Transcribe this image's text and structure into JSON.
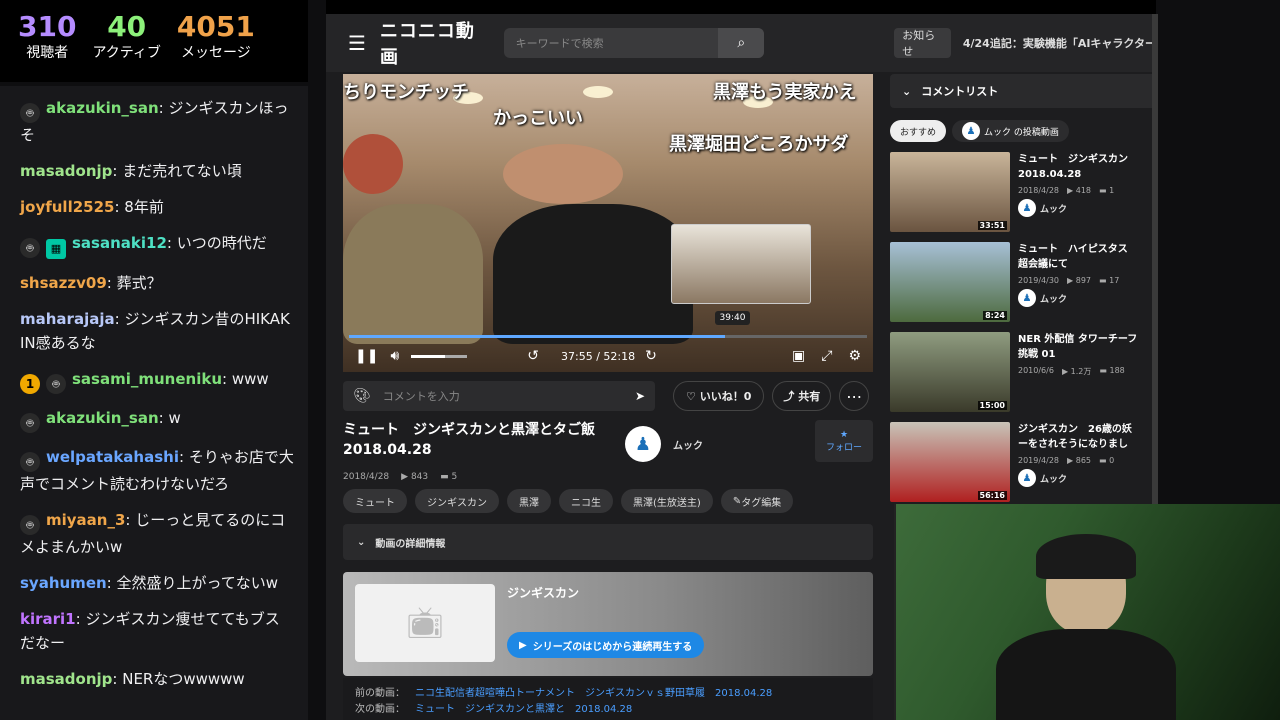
{
  "stats": [
    {
      "value": "310",
      "label": "視聴者",
      "color": "#b58cff"
    },
    {
      "value": "40",
      "label": "アクティブ",
      "color": "#8cf07a"
    },
    {
      "value": "4051",
      "label": "メッセージ",
      "color": "#f0a24a"
    }
  ],
  "chat": [
    {
      "badge": "bot",
      "user": "akazukin_san",
      "color": "#7fe07a",
      "text": "ジンギスカンほっそ"
    },
    {
      "user": "masadonjp",
      "color": "#a0e48c",
      "text": "まだ売れてない頃"
    },
    {
      "user": "joyfull2525",
      "color": "#f0a64a",
      "text": "8年前"
    },
    {
      "badge": "bot",
      "badge2": "gift",
      "user": "sasanaki12",
      "color": "#4ee0c4",
      "text": "いつの時代だ"
    },
    {
      "user": "shsazzv09",
      "color": "#f0a64a",
      "text": "葬式？"
    },
    {
      "user": "maharajaja",
      "color": "#b8c8f8",
      "text": "ジンギスカン昔のHIKAKIN感あるな"
    },
    {
      "badge": "rank",
      "rank": "1",
      "badge2": "bot",
      "user": "sasami_muneniku",
      "color": "#7fe07a",
      "text": "www"
    },
    {
      "badge": "bot",
      "user": "akazukin_san",
      "color": "#7fe07a",
      "text": "w"
    },
    {
      "badge": "bot",
      "user": "welpatakahashi",
      "color": "#6aa6ff",
      "text": "そりゃお店で大声でコメント読むわけないだろ"
    },
    {
      "badge": "bot",
      "user": "miyaan_3",
      "color": "#f0a64a",
      "text": "じーっと見てるのにコメよまんかいw"
    },
    {
      "user": "syahumen",
      "color": "#6aa6ff",
      "text": "全然盛り上がってないw"
    },
    {
      "user": "kirari1",
      "color": "#c074ff",
      "text": "ジンギスカン痩せててもブスだなー"
    },
    {
      "user": "masadonjp",
      "color": "#a0e48c",
      "text": "NERなつwwwww"
    }
  ],
  "header": {
    "logo": "ニコニコ動画",
    "search_placeholder": "キーワードで検索",
    "notice": "お知らせ",
    "notice_text": "4/24追記：実験機能「AIキャラクター"
  },
  "player": {
    "danmaku": [
      "ちりモンチッチ",
      "かっこいい",
      "黒澤もう実家かえ",
      "黒澤堀田どころかサダ"
    ],
    "tooltip_time": "39:40",
    "time": "37:55 / 52:18",
    "progress": 0.725,
    "volume": 0.6
  },
  "actions": {
    "comment_placeholder": "コメントを入力",
    "like": "いいね！0",
    "share": "共有"
  },
  "video": {
    "title": "ミュート　ジンギスカンと黒澤とタご飯 2018.04.28",
    "date": "2018/4/28",
    "views": "843",
    "comments": "5",
    "uploader": "ムック",
    "follow": "フォロー"
  },
  "tags": [
    "ミュート",
    "ジンギスカン",
    "黒澤",
    "ニコ生",
    "黒澤(生放送主)",
    "タグ編集"
  ],
  "detail_label": "動画の詳細情報",
  "series": {
    "name": "ジンギスカン",
    "play": "シリーズのはじめから連続再生する"
  },
  "prev": {
    "label": "前の動画：",
    "title": "ニコ生配信者超喧嘩凸トーナメント　ジンギスカンｖｓ野田草履　2018.04.28"
  },
  "next": {
    "label": "次の動画：",
    "title": "ミュート　ジンギスカンと黒澤と　2018.04.28"
  },
  "sidebar": {
    "heading": "コメントリスト",
    "tabs": [
      "おすすめ",
      "ムック の投稿動画"
    ],
    "items": [
      {
        "title1": "ミュート　ジンギスカン",
        "title2": "2018.04.28",
        "date": "2018/4/28",
        "views": "418",
        "comments": "1",
        "uploader": "ムック",
        "duration": "33:51",
        "colors": [
          "#c9b59a",
          "#6a5440"
        ]
      },
      {
        "title1": "ミュート　ハイピスタス",
        "title2": "超会議にて",
        "date": "2019/4/30",
        "views": "897",
        "comments": "17",
        "uploader": "ムック",
        "duration": "8:24",
        "colors": [
          "#a7c0d6",
          "#4d6a3e"
        ]
      },
      {
        "title1": "NER 外配信 タワーチーフ",
        "title2": "挑戦 01",
        "date": "2010/6/6",
        "views": "1.2万",
        "comments": "188",
        "uploader": "",
        "duration": "15:00",
        "colors": [
          "#8f9c80",
          "#3a3a2a"
        ]
      },
      {
        "title1": "ジンギスカン　26歳の妖",
        "title2": "ーをされそうになりまし",
        "date": "2019/4/28",
        "views": "865",
        "comments": "0",
        "uploader": "ムック",
        "duration": "56:16",
        "colors": [
          "#c8c3b8",
          "#b02020"
        ]
      }
    ]
  }
}
